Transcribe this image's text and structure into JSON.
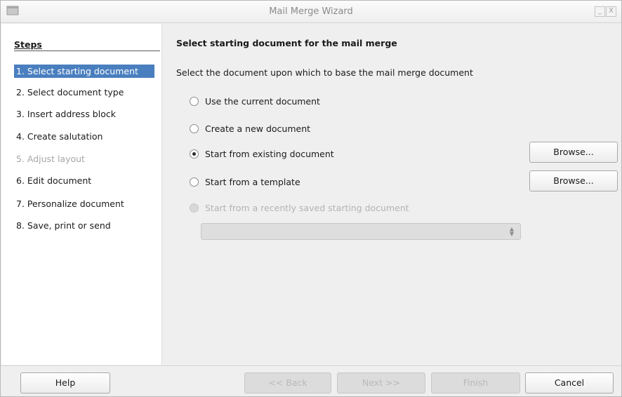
{
  "window": {
    "title": "Mail Merge Wizard",
    "minimize_symbol": "_",
    "close_symbol": "X"
  },
  "steps": {
    "heading": "Steps",
    "items": [
      {
        "label": "1. Select starting document",
        "state": "active"
      },
      {
        "label": "2. Select document type",
        "state": "normal"
      },
      {
        "label": "3. Insert address block",
        "state": "normal"
      },
      {
        "label": "4. Create salutation",
        "state": "normal"
      },
      {
        "label": "5. Adjust layout",
        "state": "disabled"
      },
      {
        "label": "6. Edit document",
        "state": "normal"
      },
      {
        "label": "7. Personalize document",
        "state": "normal"
      },
      {
        "label": "8. Save, print or send",
        "state": "normal"
      }
    ]
  },
  "content": {
    "heading": "Select starting document for the mail merge",
    "description": "Select the document upon which to base the mail merge document",
    "options": [
      {
        "label": "Use the current document",
        "checked": false,
        "enabled": true
      },
      {
        "label": "Create a new document",
        "checked": false,
        "enabled": true
      },
      {
        "label": "Start from existing document",
        "checked": true,
        "enabled": true
      },
      {
        "label": "Start from a template",
        "checked": false,
        "enabled": true
      },
      {
        "label": "Start from a recently saved starting document",
        "checked": false,
        "enabled": false
      }
    ],
    "browse_label": "Browse...",
    "recent_select_value": ""
  },
  "buttons": {
    "help": "Help",
    "back": "<< Back",
    "next": "Next >>",
    "finish": "Finish",
    "cancel": "Cancel"
  },
  "colors": {
    "active_step_bg": "#4a7fbf",
    "window_bg": "#efefef",
    "disabled_text": "#a6a6a6"
  },
  "icons": {
    "app": "window-icon",
    "radio_checked": "radio-checked-icon",
    "radio_unchecked": "radio-unchecked-icon",
    "spinner": "up-down-spinner-icon"
  }
}
